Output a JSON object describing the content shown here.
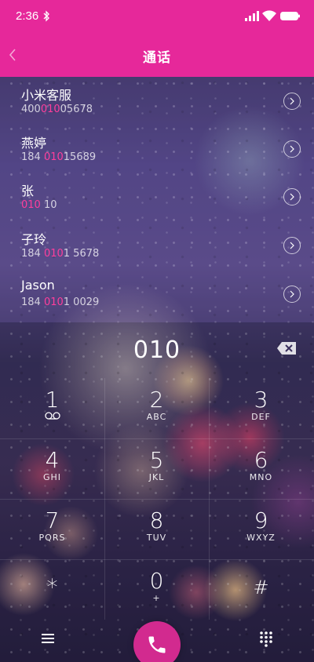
{
  "status_bar": {
    "time": "2:36"
  },
  "header": {
    "title": "通话"
  },
  "contacts": [
    {
      "name": "小米客服",
      "number_parts": [
        "400",
        "010",
        "05678"
      ]
    },
    {
      "name": "燕婷",
      "number_parts": [
        "184 ",
        "010",
        "15689"
      ]
    },
    {
      "name": "张",
      "number_parts": [
        "",
        "010",
        " 10"
      ]
    },
    {
      "name": "子玲",
      "number_parts": [
        "184 ",
        "010",
        "1 5678"
      ]
    },
    {
      "name": "Jason",
      "number_parts": [
        "184 ",
        "010",
        "1 0029"
      ]
    }
  ],
  "dialer": {
    "display": "010",
    "keys": [
      {
        "digit": "1",
        "letters": ""
      },
      {
        "digit": "2",
        "letters": "ABC"
      },
      {
        "digit": "3",
        "letters": "DEF"
      },
      {
        "digit": "4",
        "letters": "GHI"
      },
      {
        "digit": "5",
        "letters": "JKL"
      },
      {
        "digit": "6",
        "letters": "MNO"
      },
      {
        "digit": "7",
        "letters": "PQRS"
      },
      {
        "digit": "8",
        "letters": "TUV"
      },
      {
        "digit": "9",
        "letters": "WXYZ"
      },
      {
        "digit": "*",
        "letters": ""
      },
      {
        "digit": "0",
        "letters": "+"
      },
      {
        "digit": "#",
        "letters": ""
      }
    ]
  },
  "colors": {
    "accent": "#e6289a",
    "highlight_digits": "#ff3e9c",
    "call_button": "#d22a8f"
  },
  "icons": {
    "back": "chevron-left-icon",
    "bluetooth": "bluetooth-icon",
    "signal": "signal-icon",
    "wifi": "wifi-icon",
    "battery": "battery-icon",
    "detail": "chevron-right-circle-icon",
    "backspace": "backspace-icon",
    "voicemail": "voicemail-icon",
    "menu": "menu-icon",
    "call": "phone-icon",
    "dialpad": "dialpad-icon"
  }
}
